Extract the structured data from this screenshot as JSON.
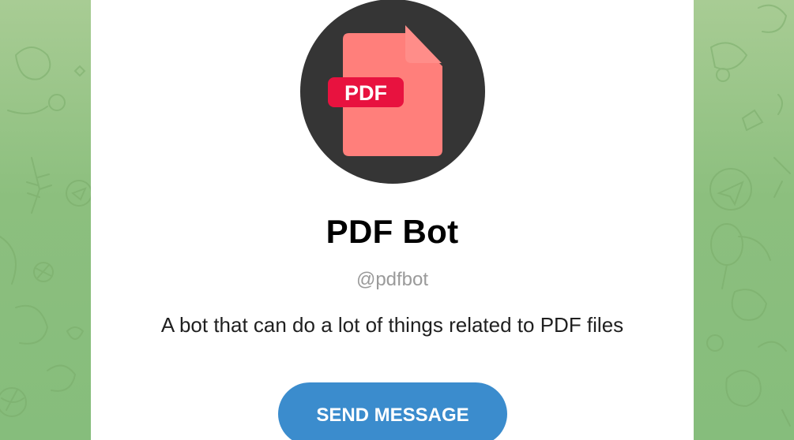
{
  "bot": {
    "name": "PDF Bot",
    "username": "@pdfbot",
    "description": "A bot that can do a lot of things related to PDF files",
    "avatar_icon": "pdf-file-icon",
    "avatar_badge": "PDF"
  },
  "actions": {
    "send_message_label": "SEND MESSAGE"
  },
  "colors": {
    "background": "#8cbf7e",
    "card": "#ffffff",
    "avatar_circle": "#353535",
    "file_body": "#ff7f7b",
    "badge": "#e8123f",
    "button": "#3b8ccd",
    "username": "#9a9a9a"
  }
}
